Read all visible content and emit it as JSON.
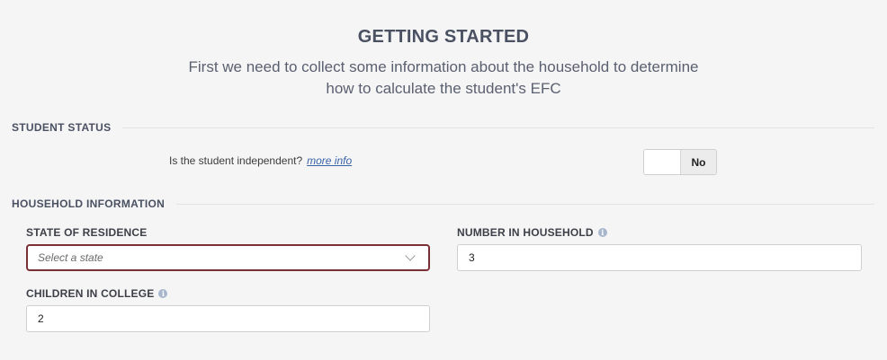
{
  "header": {
    "title": "GETTING STARTED",
    "subtitle_line1": "First we need to collect some information about the household to determine",
    "subtitle_line2": "how to calculate the student's EFC"
  },
  "student_status": {
    "section_label": "STUDENT STATUS",
    "question": "Is the student independent?",
    "more_info_link": "more info",
    "toggle_value": "No"
  },
  "household": {
    "section_label": "HOUSEHOLD INFORMATION",
    "state_label": "STATE OF RESIDENCE",
    "state_placeholder": "Select a state",
    "number_label": "NUMBER IN HOUSEHOLD",
    "number_value": "3",
    "children_label": "CHILDREN IN COLLEGE",
    "children_value": "2"
  },
  "icons": {
    "info": "info-icon",
    "dropdown": "chevron-down-icon"
  },
  "colors": {
    "heading": "#4a5162",
    "select_border_focus": "#7a2f34",
    "link": "#3a63a8",
    "background": "#f5f5f5"
  }
}
